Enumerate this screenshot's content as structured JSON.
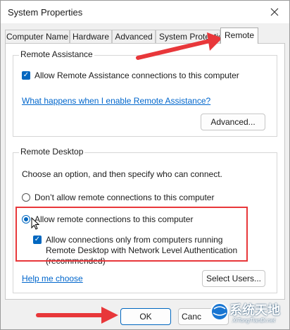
{
  "window": {
    "title": "System Properties"
  },
  "tabs": [
    {
      "label": "Computer Name"
    },
    {
      "label": "Hardware"
    },
    {
      "label": "Advanced"
    },
    {
      "label": "System Protection"
    },
    {
      "label": "Remote",
      "active": true
    }
  ],
  "remote_assistance": {
    "group_label": "Remote Assistance",
    "allow_label": "Allow Remote Assistance connections to this computer",
    "allow_checked": true,
    "help_link": "What happens when I enable Remote Assistance?",
    "advanced_button": "Advanced..."
  },
  "remote_desktop": {
    "group_label": "Remote Desktop",
    "instructions": "Choose an option, and then specify who can connect.",
    "option_dont_allow": "Don’t allow remote connections to this computer",
    "option_allow": "Allow remote connections to this computer",
    "selected_option": "allow",
    "nla_label": "Allow connections only from computers running Remote Desktop with Network Level Authentication (recommended)",
    "nla_checked": true,
    "help_link": "Help me choose",
    "select_users_button": "Select Users..."
  },
  "footer": {
    "ok_button": "OK",
    "cancel_button": "Canc"
  },
  "watermark": {
    "logo_text": "系统天地",
    "logo_sub": "XiTongTianDi.net"
  },
  "colors": {
    "accent": "#0067c0",
    "annotation": "#e8373a",
    "link": "#0066cc"
  }
}
